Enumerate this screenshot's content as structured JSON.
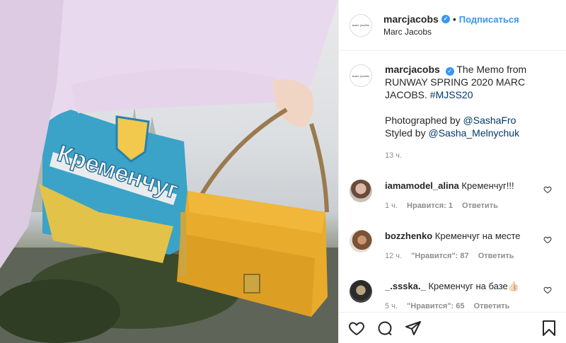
{
  "header": {
    "username": "marcjacobs",
    "follow_label": "Подписаться",
    "subtitle": "Marc Jacobs",
    "avatar_text": "marc jacobs",
    "separator": "•"
  },
  "caption": {
    "username": "marcjacobs",
    "text": "The Memo from RUNWAY SPRING 2020 MARC JACOBS.",
    "hashtag": "#MJSS20",
    "photographed_label": "Photographed by",
    "photographer": "@SashaFro",
    "styled_label": "Styled by",
    "stylist": "@Sasha_Melnychuk",
    "time": "13 ч."
  },
  "comments": [
    {
      "username": "iamamodel_alina",
      "text": "Кременчуг!!!",
      "time": "1 ч.",
      "likes": "Нравится: 1",
      "reply": "Ответить"
    },
    {
      "username": "bozzhenko",
      "text": "Кременчуг на месте",
      "time": "12 ч.",
      "likes": "\"Нравится\": 87",
      "reply": "Ответить"
    },
    {
      "username": "_.ssska._",
      "text": "Кременчуг на базе👍🏻",
      "time": "5 ч.",
      "likes": "\"Нравится\": 65",
      "reply": "Ответить"
    }
  ],
  "photo": {
    "sign_text": "Кременчуг"
  },
  "icons": [
    "heart-icon",
    "comment-icon",
    "share-icon",
    "bookmark-icon"
  ],
  "colors": {
    "link": "#3897f0",
    "hashtag": "#00376b",
    "muted": "#8e8e8e"
  }
}
